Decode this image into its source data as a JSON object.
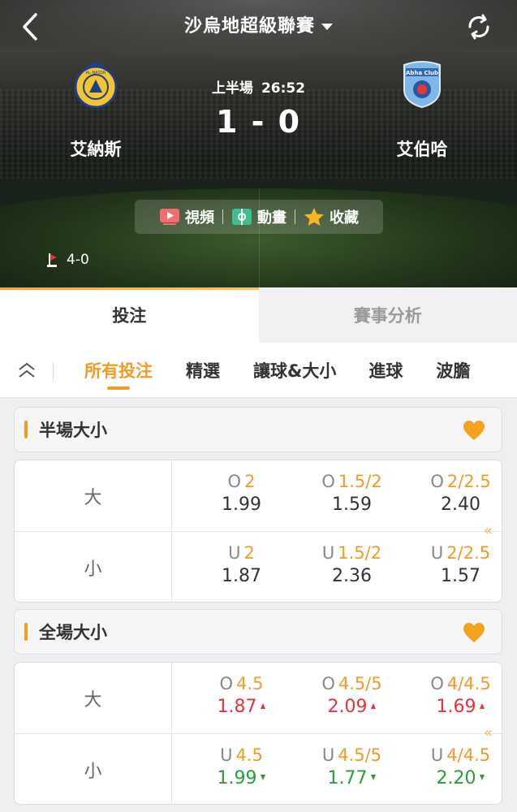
{
  "header": {
    "league": "沙烏地超級聯賽",
    "period": "上半場",
    "clock": "26:52",
    "score": "1 - 0",
    "home": {
      "name": "艾納斯",
      "badge_text": "AL NASSR"
    },
    "away": {
      "name": "艾伯哈",
      "badge_text": "Abha Club"
    },
    "media": [
      {
        "label": "視頻",
        "icon": "video-icon"
      },
      {
        "label": "動畫",
        "icon": "animation-icon"
      },
      {
        "label": "收藏",
        "icon": "star-icon"
      }
    ],
    "corners": {
      "icon": "corner-flag-icon",
      "value": "4-0"
    }
  },
  "tabs": {
    "main": [
      "投注",
      "賽事分析"
    ],
    "active_main": 0
  },
  "subtabs": {
    "items": [
      "所有投注",
      "精選",
      "讓球&大小",
      "進球",
      "波膽"
    ],
    "active": 0
  },
  "colors": {
    "accent": "#f39a26",
    "up": "#e8313a",
    "down": "#2a9c3c"
  },
  "markets": [
    {
      "title": "半場大小",
      "rows": [
        {
          "label": "大",
          "cells": [
            {
              "prefix": "O",
              "line": "2",
              "odds": "1.99",
              "trend": ""
            },
            {
              "prefix": "O",
              "line": "1.5/2",
              "odds": "1.59",
              "trend": ""
            },
            {
              "prefix": "O",
              "line": "2/2.5",
              "odds": "2.40",
              "trend": ""
            }
          ]
        },
        {
          "label": "小",
          "cells": [
            {
              "prefix": "U",
              "line": "2",
              "odds": "1.87",
              "trend": ""
            },
            {
              "prefix": "U",
              "line": "1.5/2",
              "odds": "2.36",
              "trend": ""
            },
            {
              "prefix": "U",
              "line": "2/2.5",
              "odds": "1.57",
              "trend": ""
            }
          ]
        }
      ]
    },
    {
      "title": "全場大小",
      "rows": [
        {
          "label": "大",
          "cells": [
            {
              "prefix": "O",
              "line": "4.5",
              "odds": "1.87",
              "trend": "up"
            },
            {
              "prefix": "O",
              "line": "4.5/5",
              "odds": "2.09",
              "trend": "up"
            },
            {
              "prefix": "O",
              "line": "4/4.5",
              "odds": "1.69",
              "trend": "up"
            }
          ]
        },
        {
          "label": "小",
          "cells": [
            {
              "prefix": "U",
              "line": "4.5",
              "odds": "1.99",
              "trend": "down"
            },
            {
              "prefix": "U",
              "line": "4.5/5",
              "odds": "1.77",
              "trend": "down"
            },
            {
              "prefix": "U",
              "line": "4/4.5",
              "odds": "2.20",
              "trend": "down"
            }
          ]
        }
      ]
    }
  ]
}
